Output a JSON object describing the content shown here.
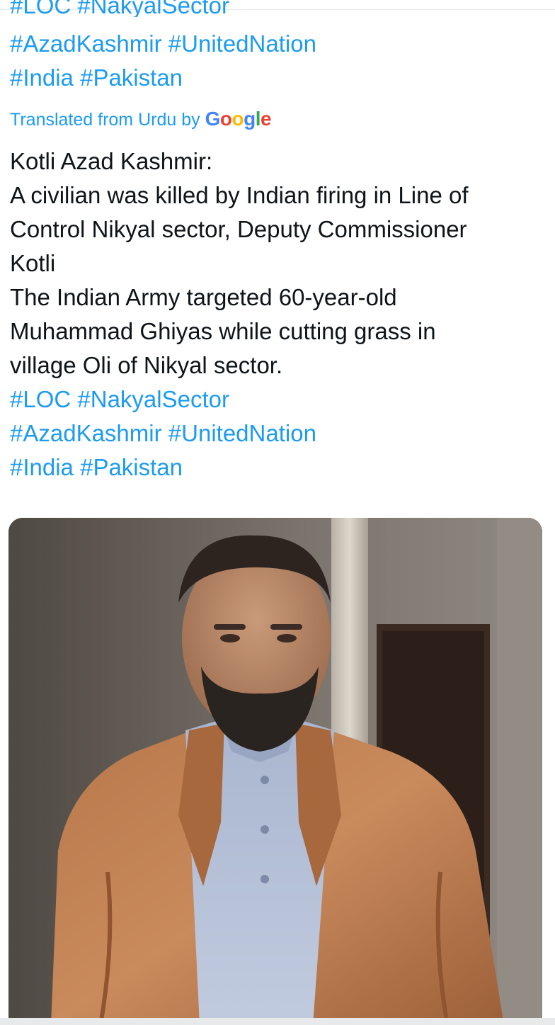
{
  "tweet": {
    "cut_top_text": "#LOC #NakyalSector",
    "top_hashtags": [
      [
        "#AzadKashmir",
        "#UnitedNation"
      ],
      [
        "#India",
        "#Pakistan"
      ]
    ],
    "translated_prefix": "Translated from Urdu by",
    "translation_brand": "Google",
    "body_lines": [
      "Kotli Azad Kashmir:",
      "A civilian was killed by Indian firing in Line of",
      "Control Nikyal sector, Deputy Commissioner",
      "Kotli",
      "The Indian Army targeted 60-year-old",
      "Muhammad Ghiyas while cutting grass in",
      "village Oli of Nikyal sector."
    ],
    "hashtags": [
      [
        "#LOC",
        "#NakyalSector"
      ],
      [
        "#AzadKashmir",
        "#UnitedNation"
      ],
      [
        "#India",
        "#Pakistan"
      ]
    ]
  },
  "colors": {
    "link": "#1d9bf0",
    "text": "#0f1419"
  },
  "media": {
    "image_icon": "photo-of-man-in-brown-jacket"
  }
}
